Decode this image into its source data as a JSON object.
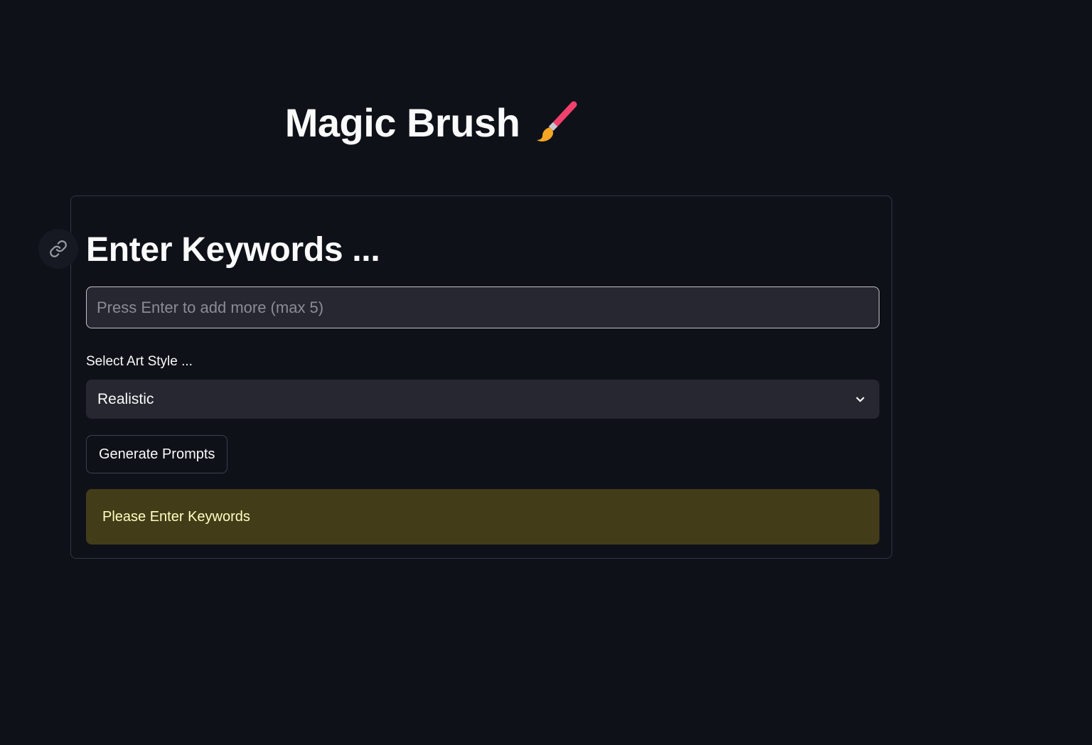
{
  "header": {
    "title": "Magic Brush",
    "title_icon": "paintbrush-icon"
  },
  "form": {
    "heading": "Enter Keywords ...",
    "anchor_icon": "link-icon",
    "keywords_input": {
      "value": "",
      "placeholder": "Press Enter to add more (max 5)"
    },
    "style_select": {
      "label": "Select Art Style ...",
      "selected": "Realistic",
      "icon": "chevron-down-icon"
    },
    "generate_button_label": "Generate Prompts",
    "warning_message": "Please Enter Keywords"
  },
  "colors": {
    "background": "#0e1118",
    "input_background": "#262730",
    "warning_background": "#433c18",
    "warning_text": "#ffffc2",
    "brush_handle": "#f0416c"
  }
}
